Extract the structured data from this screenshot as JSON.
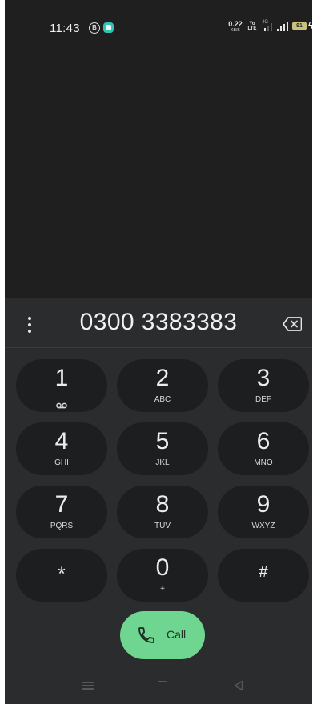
{
  "status_bar": {
    "time": "11:43",
    "notification_b": "B",
    "speed_value": "0.22",
    "speed_unit": "KB/S",
    "volte_top": "Yo",
    "volte_bottom": "LTE",
    "network": "4G",
    "battery_level": "91",
    "battery_color": "#c9c37c"
  },
  "dialer": {
    "number": "0300 3383383",
    "keys": [
      {
        "digit": "1",
        "letters": ""
      },
      {
        "digit": "2",
        "letters": "ABC"
      },
      {
        "digit": "3",
        "letters": "DEF"
      },
      {
        "digit": "4",
        "letters": "GHI"
      },
      {
        "digit": "5",
        "letters": "JKL"
      },
      {
        "digit": "6",
        "letters": "MNO"
      },
      {
        "digit": "7",
        "letters": "PQRS"
      },
      {
        "digit": "8",
        "letters": "TUV"
      },
      {
        "digit": "9",
        "letters": "WXYZ"
      },
      {
        "digit": "*",
        "letters": ""
      },
      {
        "digit": "0",
        "letters": "+"
      },
      {
        "digit": "#",
        "letters": ""
      }
    ],
    "call_label": "Call",
    "call_color": "#6ed691"
  },
  "icons": {
    "overflow": "vertical-dots-icon",
    "backspace": "backspace-icon",
    "voicemail": "voicemail-icon",
    "call": "phone-icon",
    "nav_menu": "menu-icon",
    "nav_home": "home-icon",
    "nav_back": "back-icon"
  }
}
